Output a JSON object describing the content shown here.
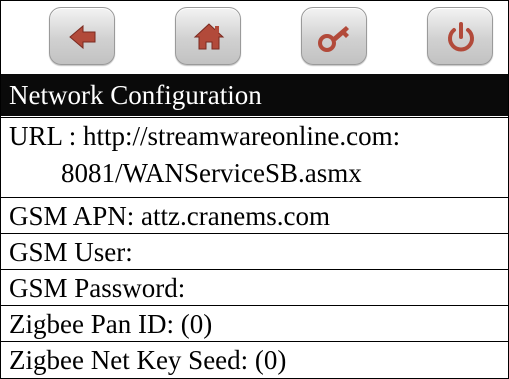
{
  "toolbar": {
    "buttons": [
      {
        "icon": "back-arrow-icon"
      },
      {
        "icon": "home-icon"
      },
      {
        "icon": "key-icon"
      },
      {
        "icon": "power-icon"
      }
    ]
  },
  "colors": {
    "title_background": "#0a0a0a",
    "title_text": "#ffffff",
    "button_icon": "#b24a3a"
  },
  "title": "Network Configuration",
  "fields": {
    "url_line1": "URL : http://streamwareonline.com:",
    "url_line2": "8081/WANServiceSB.asmx",
    "gsm_apn": "GSM APN: attz.cranems.com",
    "gsm_user": "GSM User:",
    "gsm_password": "GSM Password:",
    "zigbee_pan_id": "Zigbee Pan ID: (0)",
    "zigbee_net_key_seed": "Zigbee Net Key Seed: (0)"
  }
}
